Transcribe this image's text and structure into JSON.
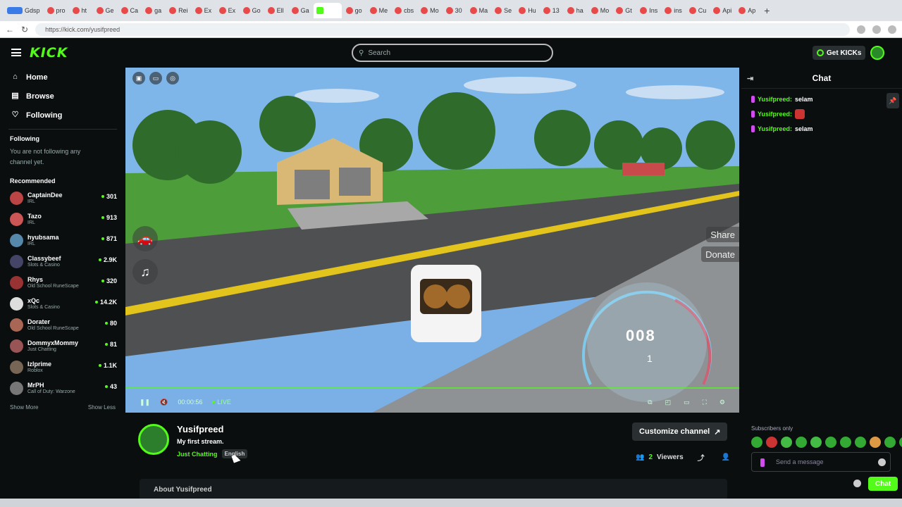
{
  "browser": {
    "url": "https://kick.com/yusifpreed",
    "tabs": [
      "Gdsp",
      "pro",
      "ht",
      "Ge",
      "Ca",
      "ga",
      "Rei",
      "Ex",
      "Ex",
      "Go",
      "Ell",
      "Ga",
      "",
      "go",
      "Me",
      "cbs",
      "Mo",
      "30",
      "Ma",
      "Se",
      "Hu",
      "13",
      "ha",
      "Mo",
      "Gt",
      "Ins",
      "ins",
      "Cu",
      "Api",
      "Ap"
    ]
  },
  "topnav": {
    "logo": "KICK",
    "search_placeholder": "Search",
    "get_kicks": "Get KICKs"
  },
  "sidebar": {
    "nav": [
      {
        "label": "Home",
        "icon": "home-icon"
      },
      {
        "label": "Browse",
        "icon": "browse-icon"
      },
      {
        "label": "Following",
        "icon": "heart-icon"
      }
    ],
    "following_header": "Following",
    "following_note": "You are not following any channel yet.",
    "recommended_header": "Recommended",
    "recommended": [
      {
        "name": "CaptainDee",
        "category": "IRL",
        "viewers": "301",
        "color": "#b44"
      },
      {
        "name": "Tazo",
        "category": "IRL",
        "viewers": "913",
        "color": "#c55"
      },
      {
        "name": "hyubsama",
        "category": "IRL",
        "viewers": "871",
        "color": "#58a"
      },
      {
        "name": "Classybeef",
        "category": "Slots & Casino",
        "viewers": "2.9K",
        "color": "#446"
      },
      {
        "name": "Rhys",
        "category": "Old School RuneScape",
        "viewers": "320",
        "color": "#933"
      },
      {
        "name": "xQc",
        "category": "Slots & Casino",
        "viewers": "14.2K",
        "color": "#ddd"
      },
      {
        "name": "Dorater",
        "category": "Old School RuneScape",
        "viewers": "80",
        "color": "#a65"
      },
      {
        "name": "DommyxMommy",
        "category": "Just Chatting",
        "viewers": "81",
        "color": "#955"
      },
      {
        "name": "Izlprime",
        "category": "Roblox",
        "viewers": "1.1K",
        "color": "#765"
      },
      {
        "name": "MrPH",
        "category": "Call of Duty: Warzone",
        "viewers": "43",
        "color": "#777"
      }
    ],
    "show_more": "Show More",
    "show_less": "Show Less"
  },
  "video": {
    "time": "00:00:56",
    "live_label": "LIVE",
    "share_label": "Share",
    "donate_label": "Donate",
    "speed_readout": "008",
    "gear_readout": "1"
  },
  "channel": {
    "name": "Yusifpreed",
    "title": "My first stream.",
    "category": "Just Chatting",
    "language": "English",
    "customize": "Customize channel",
    "viewers": "2",
    "viewers_label": "Viewers",
    "about": "About Yusifpreed"
  },
  "chat": {
    "title": "Chat",
    "messages": [
      {
        "user": "Yusifpreed:",
        "text": "selam"
      },
      {
        "user": "Yusifpreed:",
        "text": ""
      },
      {
        "user": "Yusifpreed:",
        "text": "selam"
      }
    ],
    "subscribers_only": "Subscribers only",
    "input_placeholder": "Send a message",
    "send_label": "Chat"
  }
}
